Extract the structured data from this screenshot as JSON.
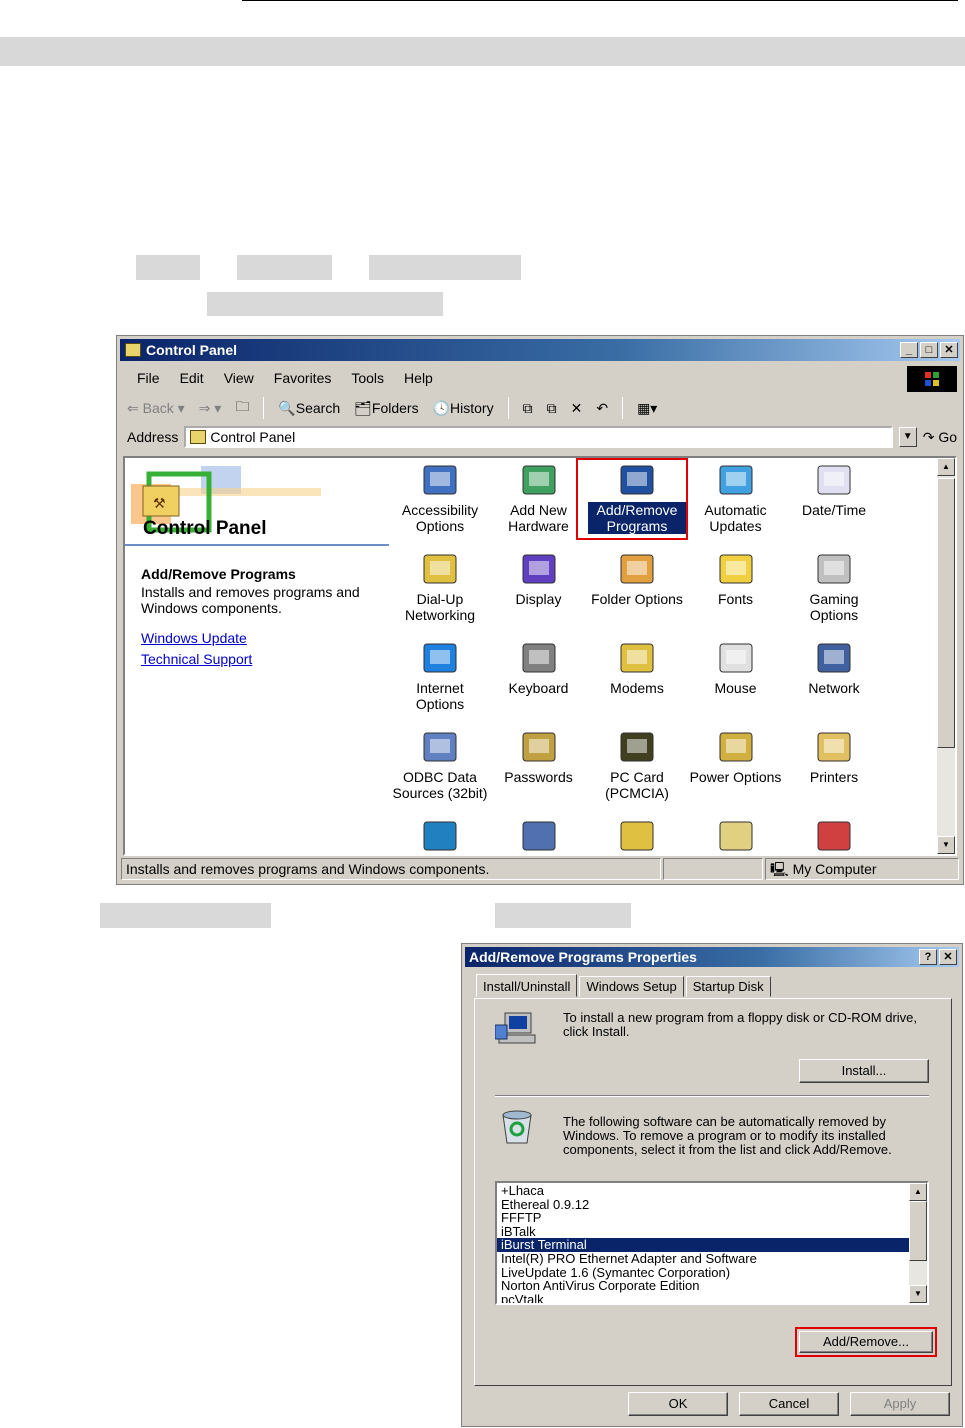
{
  "window": {
    "title": "Control Panel",
    "menu": [
      "File",
      "Edit",
      "View",
      "Favorites",
      "Tools",
      "Help"
    ],
    "toolbar": {
      "back": "Back",
      "search": "Search",
      "folders": "Folders",
      "history": "History"
    },
    "address_label": "Address",
    "address_value": "Control Panel",
    "go": "Go",
    "left_title": "Control Panel",
    "selected_title": "Add/Remove Programs",
    "selected_desc": "Installs and removes programs and Windows components.",
    "links": [
      "Windows Update",
      "Technical Support"
    ],
    "icons": [
      [
        "Accessibility",
        "Options"
      ],
      [
        "Add New",
        "Hardware"
      ],
      [
        "Add/Remove",
        "Programs"
      ],
      [
        "Automatic",
        "Updates"
      ],
      [
        "Date/Time",
        ""
      ],
      [
        "Dial-Up",
        "Networking"
      ],
      [
        "Display",
        ""
      ],
      [
        "Folder Options",
        ""
      ],
      [
        "Fonts",
        ""
      ],
      [
        "Gaming",
        "Options"
      ],
      [
        "Internet",
        "Options"
      ],
      [
        "Keyboard",
        ""
      ],
      [
        "Modems",
        ""
      ],
      [
        "Mouse",
        ""
      ],
      [
        "Network",
        ""
      ],
      [
        "ODBC Data",
        "Sources (32bit)"
      ],
      [
        "Passwords",
        ""
      ],
      [
        "PC Card",
        "(PCMCIA)"
      ],
      [
        "Power Options",
        ""
      ],
      [
        "Printers",
        ""
      ]
    ],
    "icon_names": [
      "accessibility-icon",
      "add-hardware-icon",
      "add-remove-programs-icon",
      "automatic-updates-icon",
      "date-time-icon",
      "dial-up-networking-icon",
      "display-icon",
      "folder-options-icon",
      "fonts-icon",
      "gaming-options-icon",
      "internet-options-icon",
      "keyboard-icon",
      "modems-icon",
      "mouse-icon",
      "network-icon",
      "odbc-icon",
      "passwords-icon",
      "pc-card-icon",
      "power-options-icon",
      "printers-icon"
    ],
    "status_text": "Installs and removes programs and Windows components.",
    "status_zone": "My Computer"
  },
  "dialog": {
    "title": "Add/Remove Programs Properties",
    "tabs": [
      "Install/Uninstall",
      "Windows Setup",
      "Startup Disk"
    ],
    "install_text": "To install a new program from a floppy disk or CD-ROM drive, click Install.",
    "install_button": "Install...",
    "remove_text": "The following software can be automatically removed by Windows. To remove a program or to modify its installed components, select it from the list and click Add/Remove.",
    "programs": [
      "+Lhaca",
      "Ethereal 0.9.12",
      "FFFTP",
      "iBTalk",
      "iBurst Terminal",
      "Intel(R) PRO Ethernet Adapter and Software",
      "LiveUpdate 1.6 (Symantec Corporation)",
      "Norton AntiVirus Corporate Edition",
      "pcVtalk"
    ],
    "selected_program": "iBurst Terminal",
    "add_remove_button": "Add/Remove...",
    "ok": "OK",
    "cancel": "Cancel",
    "apply": "Apply"
  },
  "colors": {
    "title_blue": "#0a246a",
    "highlight_red": "#e00000",
    "face": "#d4d0c8"
  }
}
